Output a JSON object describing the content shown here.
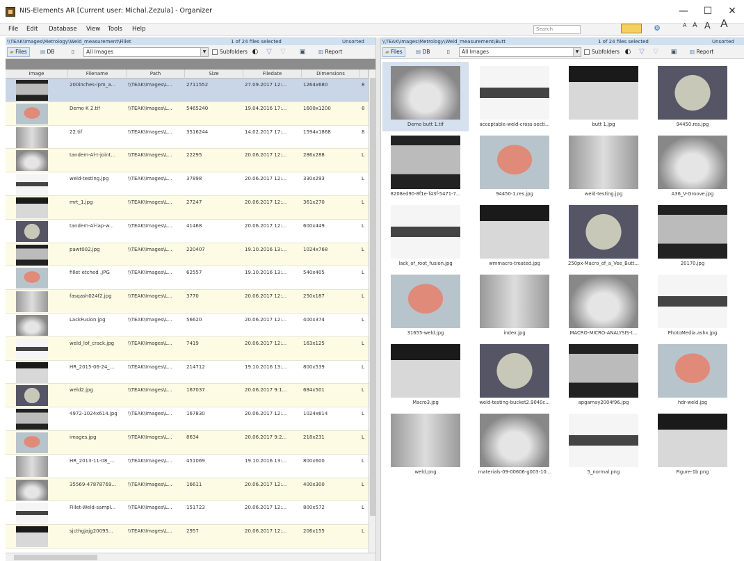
{
  "window": {
    "title": "NIS-Elements AR  [Current user: Michal.Zezula] - Organizer",
    "minimize": "—",
    "maximize": "☐",
    "close": "✕"
  },
  "menu": [
    "File",
    "Edit",
    "Database",
    "View",
    "Tools",
    "Help"
  ],
  "search": {
    "placeholder": "Search"
  },
  "font_sizes": [
    "A",
    "A",
    "A",
    "A"
  ],
  "left": {
    "path": "\\\\TEAK\\Images\\Metrology\\Weld_measurement\\Fillet",
    "selection": "1 of 24 files selected",
    "sort": "Unsorted",
    "files_tab": "Files",
    "db_tab": "DB",
    "filter": "All Images",
    "subfolders": "Subfolders",
    "report": "Report",
    "columns": [
      "Image",
      "Filename",
      "Path",
      "Size",
      "Filedate",
      "Dimensions"
    ],
    "rows": [
      {
        "filename": "200inches-ipm_a...",
        "path": "\\\\TEAK\\Images\\L...",
        "size": "2711552",
        "date": "27.09.2017 12:...",
        "dims": "1264x680",
        "extra": "8"
      },
      {
        "filename": "Demo K 2.tif",
        "path": "\\\\TEAK\\Images\\L...",
        "size": "5465240",
        "date": "19.04.2016 17:...",
        "dims": "1600x1200",
        "extra": "8"
      },
      {
        "filename": "22.tif",
        "path": "\\\\TEAK\\Images\\L...",
        "size": "3516244",
        "date": "14.02.2017 17:...",
        "dims": "1594x1868",
        "extra": "8"
      },
      {
        "filename": "tandem-Al-t-joint...",
        "path": "\\\\TEAK\\Images\\L...",
        "size": "22295",
        "date": "20.06.2017 12:...",
        "dims": "286x288",
        "extra": "L"
      },
      {
        "filename": "weld-testing.jpg",
        "path": "\\\\TEAK\\Images\\L...",
        "size": "37898",
        "date": "20.06.2017 12:...",
        "dims": "330x293",
        "extra": "L"
      },
      {
        "filename": "mrt_1.jpg",
        "path": "\\\\TEAK\\Images\\L...",
        "size": "27247",
        "date": "20.06.2017 12:...",
        "dims": "361x270",
        "extra": "L"
      },
      {
        "filename": "tandem-Al-lap-w...",
        "path": "\\\\TEAK\\Images\\L...",
        "size": "41468",
        "date": "20.06.2017 12:...",
        "dims": "600x449",
        "extra": "L"
      },
      {
        "filename": "pawt002.jpg",
        "path": "\\\\TEAK\\Images\\L...",
        "size": "220407",
        "date": "19.10.2016 13:...",
        "dims": "1024x768",
        "extra": "L"
      },
      {
        "filename": "fillet etched .JPG",
        "path": "\\\\TEAK\\Images\\L...",
        "size": "62557",
        "date": "19.10.2016 13:...",
        "dims": "540x405",
        "extra": "L"
      },
      {
        "filename": "fasqash024f2.jpg",
        "path": "\\\\TEAK\\Images\\L...",
        "size": "3770",
        "date": "20.06.2017 12:...",
        "dims": "250x187",
        "extra": "L"
      },
      {
        "filename": "LackFusion.jpg",
        "path": "\\\\TEAK\\Images\\L...",
        "size": "56620",
        "date": "20.06.2017 12:...",
        "dims": "400x374",
        "extra": "L"
      },
      {
        "filename": "weld_lof_crack.jpg",
        "path": "\\\\TEAK\\Images\\L...",
        "size": "7419",
        "date": "20.06.2017 12:...",
        "dims": "163x125",
        "extra": "L"
      },
      {
        "filename": "HR_2015-06-24_...",
        "path": "\\\\TEAK\\Images\\L...",
        "size": "214712",
        "date": "19.10.2016 13:...",
        "dims": "800x539",
        "extra": "L"
      },
      {
        "filename": "weld2.jpg",
        "path": "\\\\TEAK\\Images\\L...",
        "size": "167037",
        "date": "20.06.2017 9:1...",
        "dims": "684x501",
        "extra": "L"
      },
      {
        "filename": "4972-1024x614.jpg",
        "path": "\\\\TEAK\\Images\\L...",
        "size": "167830",
        "date": "20.06.2017 12:...",
        "dims": "1024x614",
        "extra": "L"
      },
      {
        "filename": "images.jpg",
        "path": "\\\\TEAK\\Images\\L...",
        "size": "8634",
        "date": "20.06.2017 9:2...",
        "dims": "218x231",
        "extra": "L"
      },
      {
        "filename": "HR_2013-11-08_...",
        "path": "\\\\TEAK\\Images\\L...",
        "size": "451069",
        "date": "19.10.2016 13:...",
        "dims": "800x600",
        "extra": "L"
      },
      {
        "filename": "35569-47878769...",
        "path": "\\\\TEAK\\Images\\L...",
        "size": "16611",
        "date": "20.06.2017 12:...",
        "dims": "400x300",
        "extra": "L"
      },
      {
        "filename": "Fillet-Weld-sampl...",
        "path": "\\\\TEAK\\Images\\L...",
        "size": "151723",
        "date": "20.06.2017 12:...",
        "dims": "800x572",
        "extra": "L"
      },
      {
        "filename": "sjcthgjajg20095...",
        "path": "\\\\TEAK\\Images\\L...",
        "size": "2957",
        "date": "20.06.2017 12:...",
        "dims": "206x155",
        "extra": "L"
      }
    ]
  },
  "right": {
    "path": "\\\\TEAK\\Images\\Metrology\\Weld_measurement\\Butt",
    "selection": "1 of 24 files selected",
    "sort": "Unsorted",
    "files_tab": "Files",
    "db_tab": "DB",
    "filter": "All Images",
    "subfolders": "Subfolders",
    "report": "Report",
    "tiles": [
      "Demo butt 1.tif",
      "acceptable-weld-cross-secti...",
      "butt 1.jpg",
      "94450.res.jpg",
      "8208ed90-8f1e-f43f-5471-7...",
      "94450-1.res.jpg",
      "weld-testing.jpg",
      "A36_V-Groove.jpg",
      "lack_of_root_fusion.jpg",
      "wmmacro-treated.jpg",
      "250px-Macro_of_a_Vee_Butt...",
      "20170.jpg",
      "31655-weld.jpg",
      "index.jpg",
      "MACRO-MICRO-ANALYSIS-t...",
      "PhotoMedia.ashx.jpg",
      "Macro3.jpg",
      "weld-testing-bucket2.9040c...",
      "apgamay2004f96.jpg",
      "hdr-weld.jpg",
      "weld.png",
      "materials-09-00606-g003-10...",
      "5_normal.png",
      "Figure-1b.png"
    ]
  },
  "colors": {
    "selected": "#c8d6e8",
    "row_alt": "#fdfbe4",
    "pathbar": "#cfe0f1"
  }
}
